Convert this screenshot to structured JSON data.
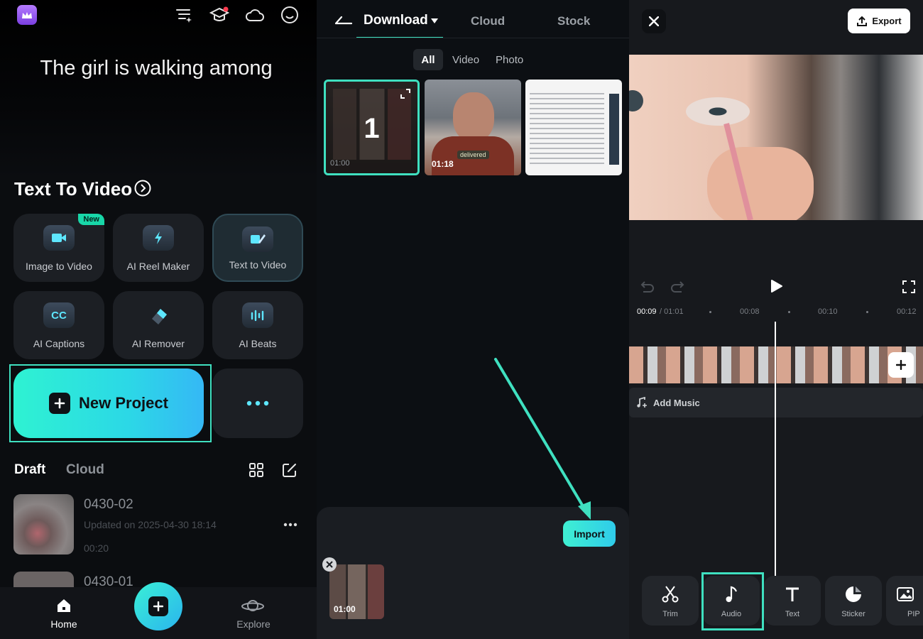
{
  "home": {
    "hero_text": "The girl is walking among",
    "section_title": "Text To Video",
    "tools": [
      {
        "label": "Image to Video",
        "badge": "New"
      },
      {
        "label": "AI Reel Maker"
      },
      {
        "label": "Text to Video"
      },
      {
        "label": "AI Captions",
        "glyph": "CC"
      },
      {
        "label": "AI Remover"
      },
      {
        "label": "AI Beats"
      }
    ],
    "new_project": "New Project",
    "draft_tabs": [
      "Draft",
      "Cloud"
    ],
    "drafts": [
      {
        "title": "0430-02",
        "updated": "Updated on 2025-04-30 18:14",
        "duration": "00:20"
      },
      {
        "title": "0430-01"
      }
    ],
    "nav": {
      "home": "Home",
      "explore": "Explore"
    }
  },
  "import_screen": {
    "tabs": [
      "Download",
      "Cloud",
      "Stock"
    ],
    "filters": [
      "All",
      "Video",
      "Photo"
    ],
    "media": [
      {
        "index": "1",
        "duration": "01:00"
      },
      {
        "duration": "01:18",
        "caption": "delivered"
      },
      {}
    ],
    "import_button": "Import",
    "selected_duration": "01:00",
    "accent": "#3fe0c0"
  },
  "editor": {
    "export_label": "Export",
    "time_current": "00:09",
    "time_total": "/ 01:01",
    "ruler": [
      "00:08",
      "00:10",
      "00:12"
    ],
    "add_music": "Add Music",
    "tools": [
      "Trim",
      "Audio",
      "Text",
      "Sticker",
      "PIP"
    ]
  }
}
